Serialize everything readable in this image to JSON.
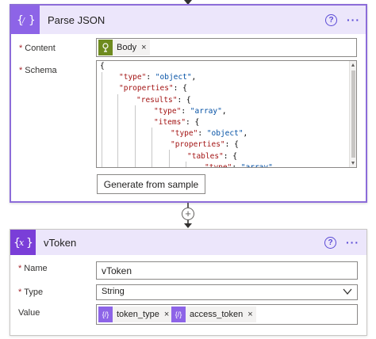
{
  "parse_json": {
    "title": "Parse JSON",
    "help_label": "?",
    "more_label": "···",
    "content_label": "Content",
    "content_token": {
      "label": "Body",
      "remove": "×",
      "icon": "body-token-icon",
      "color": "#6e8b1f"
    },
    "schema_label": "Schema",
    "schema_lines": [
      {
        "indent": 0,
        "text": "{"
      },
      {
        "indent": 1,
        "key": "\"type\"",
        "sep": ": ",
        "val": "\"object\"",
        "end": ","
      },
      {
        "indent": 1,
        "key": "\"properties\"",
        "sep": ": {",
        "val": "",
        "end": ""
      },
      {
        "indent": 2,
        "key": "\"results\"",
        "sep": ": {",
        "val": "",
        "end": ""
      },
      {
        "indent": 3,
        "key": "\"type\"",
        "sep": ": ",
        "val": "\"array\"",
        "end": ","
      },
      {
        "indent": 3,
        "key": "\"items\"",
        "sep": ": {",
        "val": "",
        "end": ""
      },
      {
        "indent": 4,
        "key": "\"type\"",
        "sep": ": ",
        "val": "\"object\"",
        "end": ","
      },
      {
        "indent": 4,
        "key": "\"properties\"",
        "sep": ": {",
        "val": "",
        "end": ""
      },
      {
        "indent": 5,
        "key": "\"tables\"",
        "sep": ": {",
        "val": "",
        "end": ""
      },
      {
        "indent": 6,
        "key": "\"type\"",
        "sep": ": ",
        "val": "\"array\"",
        "end": ","
      }
    ],
    "generate_button": "Generate from sample",
    "header_icon": "braces-icon",
    "accent": "#8d64e7"
  },
  "connector": {
    "add_label": "+"
  },
  "vtoken": {
    "title": "vToken",
    "help_label": "?",
    "more_label": "···",
    "name_label": "Name",
    "name_value": "vToken",
    "type_label": "Type",
    "type_value": "String",
    "value_label": "Value",
    "value_tokens": [
      {
        "label": "token_type",
        "remove": "×"
      },
      {
        "label": "access_token",
        "remove": "×"
      }
    ],
    "header_icon": "variable-x-icon",
    "accent": "#7a3ed8"
  }
}
